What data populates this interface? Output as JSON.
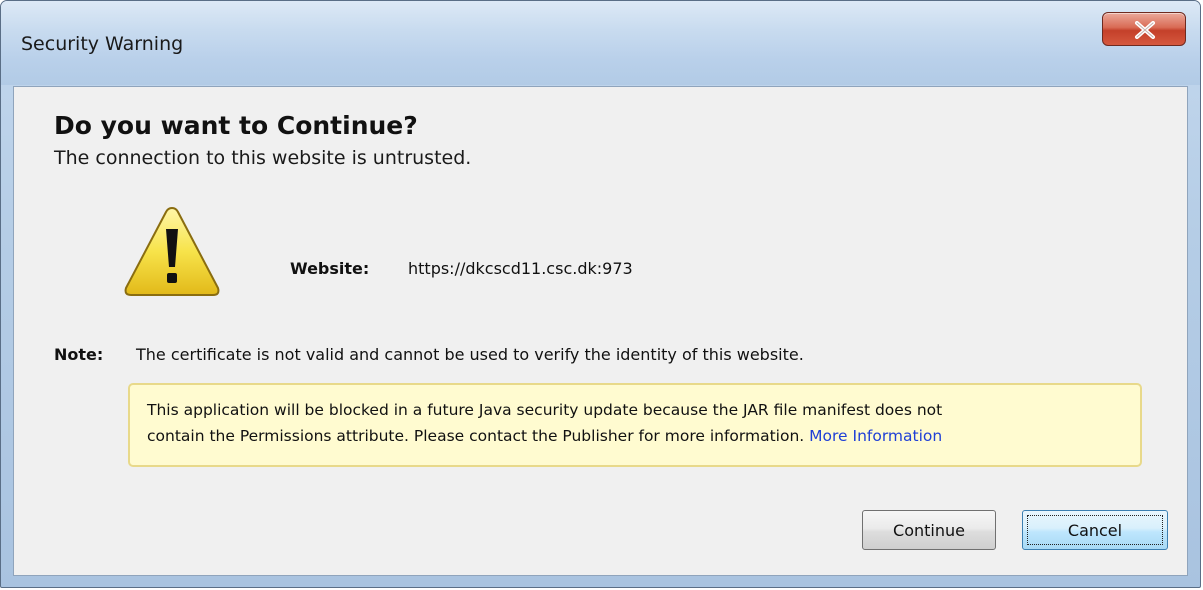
{
  "window": {
    "title": "Security Warning",
    "close_icon": "close-x-icon"
  },
  "dialog": {
    "heading": "Do you want to Continue?",
    "subheading": "The connection to this website is untrusted.",
    "warning_icon": "warning-triangle-icon",
    "website_label": "Website:",
    "website_url": "https://dkcscd11.csc.dk:973",
    "note_label": "Note:",
    "note_text": "The certificate is not valid and cannot be used to verify the identity of this website.",
    "info": {
      "line1": "This application will be blocked in a future Java security update because the JAR file manifest does not",
      "line2": "contain the Permissions attribute. Please contact the Publisher for more information.",
      "link": "More Information"
    }
  },
  "buttons": {
    "continue": "Continue",
    "cancel": "Cancel"
  },
  "colors": {
    "link": "#1f3fd6",
    "info_background": "#fffbd0",
    "close_button": "#c4402a"
  }
}
